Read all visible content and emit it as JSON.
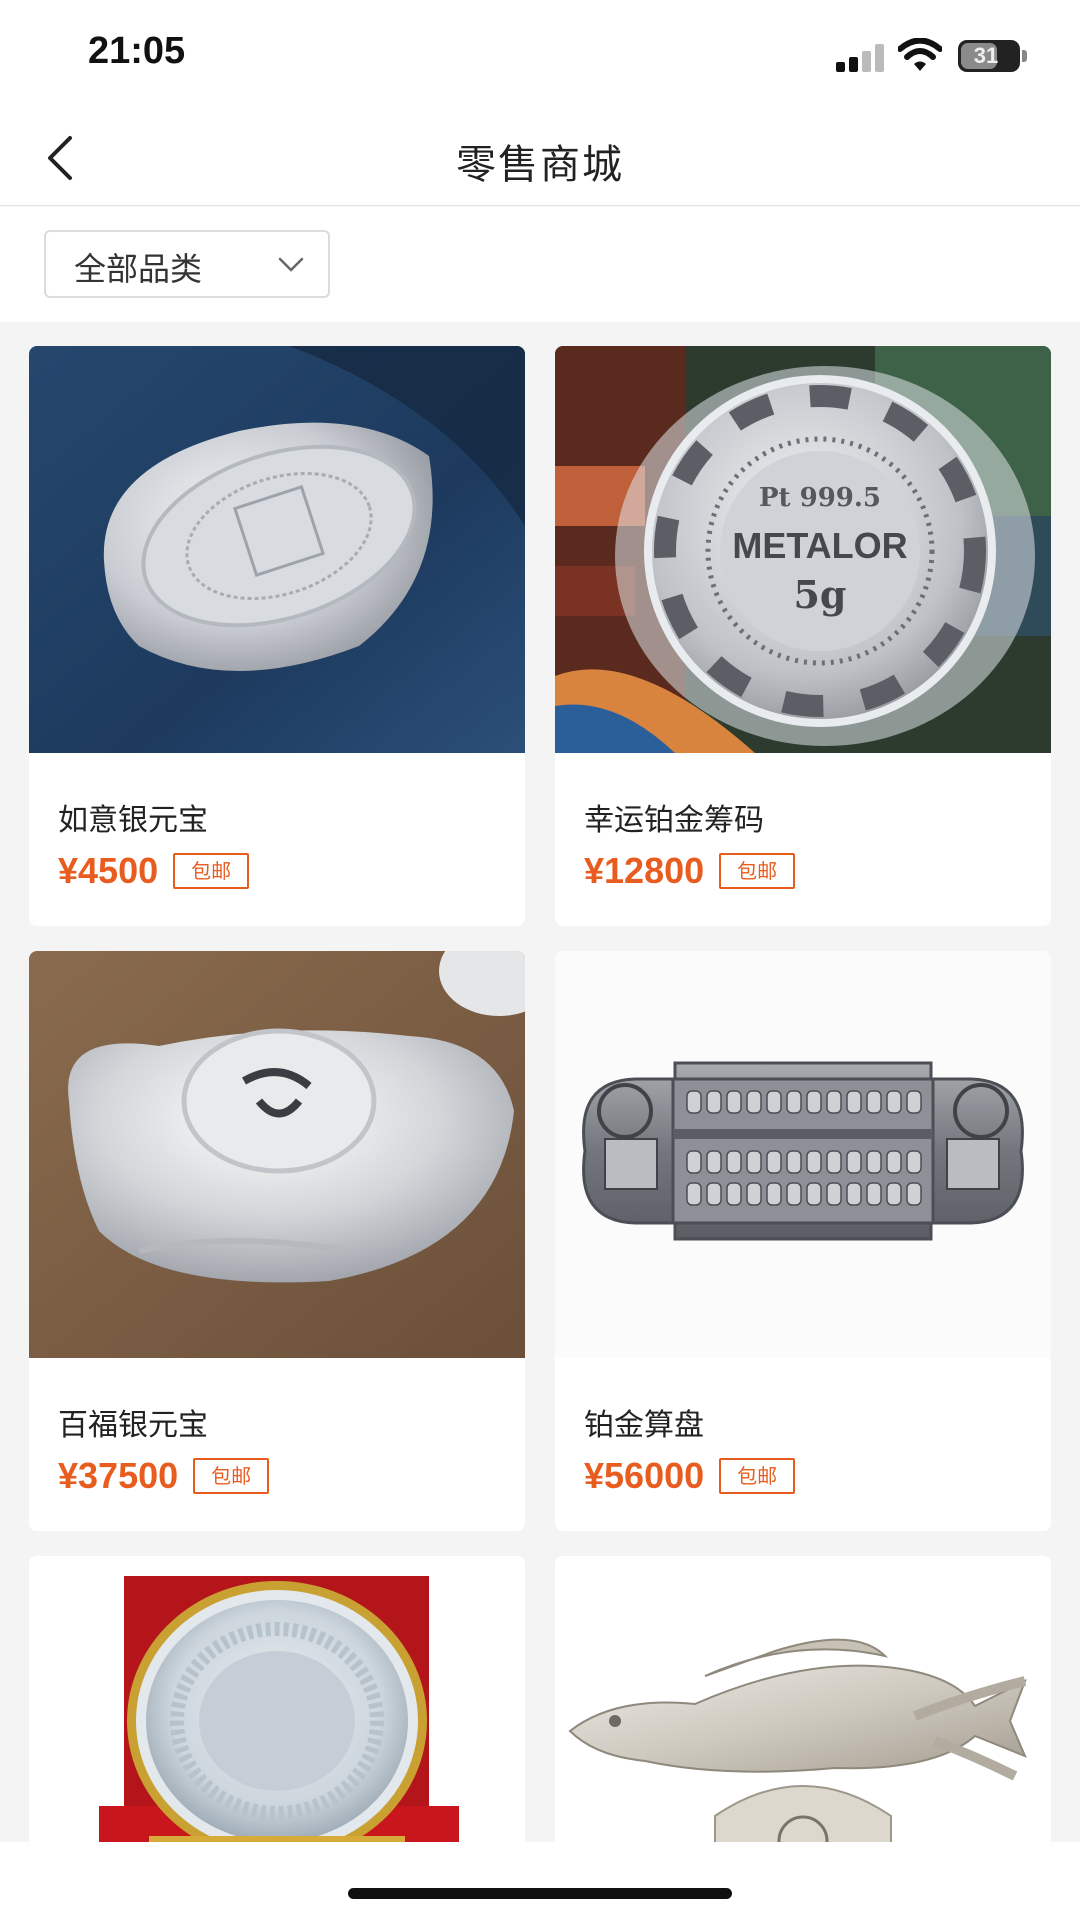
{
  "status_bar": {
    "time": "21:05",
    "battery": "31",
    "icons": [
      "signal-icon",
      "wifi-icon",
      "battery-icon"
    ]
  },
  "nav": {
    "title": "零售商城",
    "back_icon": "chevron-left-icon"
  },
  "filter": {
    "category_selected": "全部品类",
    "dropdown_icon": "chevron-down-icon"
  },
  "products": [
    {
      "name": "如意银元宝",
      "price": "¥4500",
      "badge": "包邮",
      "image": "silver-ingot-image"
    },
    {
      "name": "幸运铂金筹码",
      "price": "¥12800",
      "badge": "包邮",
      "image": "platinum-chip-image"
    },
    {
      "name": "百福银元宝",
      "price": "¥37500",
      "badge": "包邮",
      "image": "silver-ingot-fu-image"
    },
    {
      "name": "铂金算盘",
      "price": "¥56000",
      "badge": "包邮",
      "image": "platinum-abacus-image"
    },
    {
      "image": "silver-plate-image"
    },
    {
      "image": "silver-arowana-image"
    }
  ],
  "coin_text": {
    "purity": "Pt 999.5",
    "brand": "METALOR",
    "weight": "5g"
  },
  "colors": {
    "price": "#e85d1f",
    "background": "#f4f4f4"
  }
}
